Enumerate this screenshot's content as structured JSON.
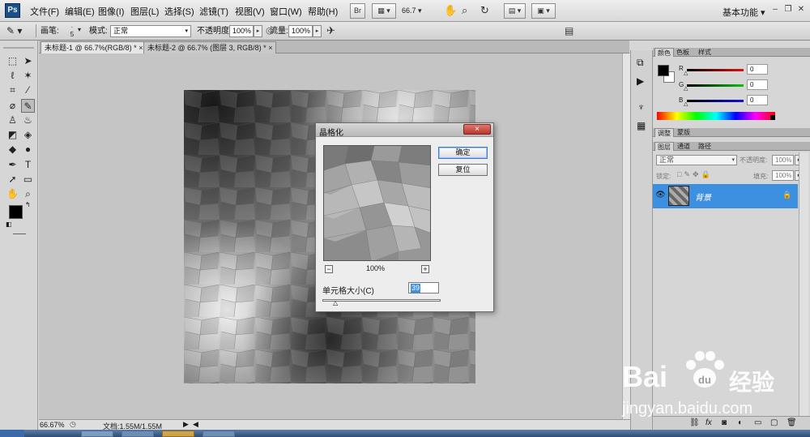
{
  "app": {
    "logo": "Ps",
    "workspace": "基本功能",
    "zoom_field": "66.7"
  },
  "menu": [
    "文件(F)",
    "编辑(E)",
    "图像(I)",
    "图层(L)",
    "选择(S)",
    "滤镜(T)",
    "视图(V)",
    "窗口(W)",
    "帮助(H)"
  ],
  "menubar_buttons": {
    "bridge": "Br"
  },
  "options_bar": {
    "brush_label": "画笔:",
    "brush_size": "5",
    "mode_label": "模式:",
    "mode_value": "正常",
    "opacity_label": "不透明度:",
    "opacity_value": "100%",
    "flow_label": "流量:",
    "flow_value": "100%"
  },
  "tabs": [
    {
      "label": "未标题-1 @ 66.7%(RGB/8) *",
      "close": "×"
    },
    {
      "label": "未标题-2 @ 66.7% (图层 3, RGB/8) *",
      "close": "×"
    }
  ],
  "status": {
    "zoom": "66.67%",
    "doc": "文档:1.55M/1.55M"
  },
  "color_panel": {
    "tabs": [
      "颜色",
      "色板",
      "样式"
    ],
    "channels": [
      {
        "name": "R",
        "value": "0",
        "color": "#d11"
      },
      {
        "name": "G",
        "value": "0",
        "color": "#1a1"
      },
      {
        "name": "B",
        "value": "0",
        "color": "#11c"
      }
    ]
  },
  "adjust_tabs": [
    "调整",
    "蒙版"
  ],
  "layers_panel": {
    "tabs": [
      "图层",
      "通道",
      "路径"
    ],
    "blend_mode": "正常",
    "opacity_label": "不透明度:",
    "opacity_value": "100%",
    "lock_label": "锁定:",
    "fill_label": "填充:",
    "fill_value": "100%",
    "layers": [
      {
        "name": "背景",
        "selected": true
      }
    ]
  },
  "dialog": {
    "title": "晶格化",
    "ok": "确定",
    "reset": "复位",
    "zoom": "100%",
    "minus": "−",
    "plus": "+",
    "cell_size_label": "单元格大小(C)",
    "cell_size_value": "39",
    "close": "×"
  },
  "watermark": {
    "brand": "Bai",
    "brand_cn": "经验",
    "url": "jingyan.baidu.com"
  },
  "colors": {
    "accent": "#3d8fe0",
    "selected_layer": "#3d8fe0",
    "titlebar_close": "#c9463d"
  }
}
